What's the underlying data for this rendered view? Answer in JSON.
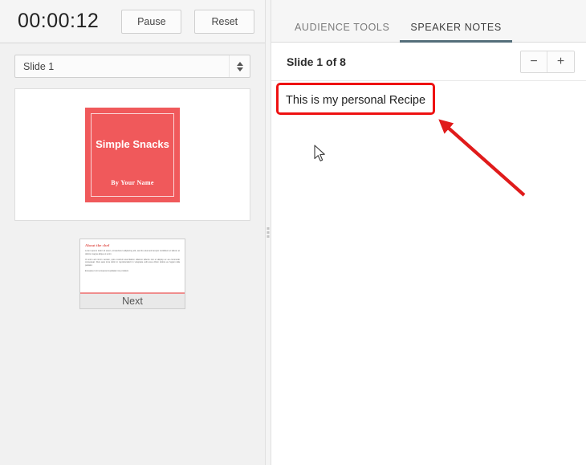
{
  "left_panel": {
    "timer": {
      "value": "00:00:12",
      "pause_label": "Pause",
      "reset_label": "Reset"
    },
    "slide_selector": {
      "value": "Slide 1",
      "spinner_up_icon": "caret-up-icon",
      "spinner_down_icon": "caret-down-icon"
    },
    "current_slide": {
      "title": "Simple Snacks",
      "subtitle": "By Your Name",
      "accent_color": "#f0595b"
    },
    "next_slide": {
      "label": "Next",
      "heading": "About the chef",
      "paragraphs": [
        "Lorem ipsum dolor sit amet, consectetur adipiscing elit, sed do eiusmod tempor incididunt ut labore et dolore magna aliqua ut enim.",
        "Ut enim ad minim veniam, quis nostrud exercitation ullamco laboris nisi ut aliquip ex ea commodo consequat. Duis aute irure dolor in reprehenderit in voluptate velit esse cillum dolore eu fugiat nulla pariatur.",
        "Excepteur sint occaecat cupidatat non proident."
      ]
    }
  },
  "splitter": {
    "grip_icon": "drag-handle-icon"
  },
  "right_panel": {
    "tabs": [
      {
        "label": "AUDIENCE TOOLS",
        "active": false
      },
      {
        "label": "SPEAKER NOTES",
        "active": true
      }
    ],
    "active_tab_underline_color": "#546e7a",
    "notes_header": {
      "counter": "Slide 1 of 8",
      "zoom_out_label": "−",
      "zoom_in_label": "+"
    },
    "notes": {
      "text": "This is my personal Recipe"
    }
  },
  "annotations": {
    "highlight_color": "#ee1111",
    "arrow_color": "#e01b1b",
    "cursor_icon": "mouse-pointer-icon"
  }
}
